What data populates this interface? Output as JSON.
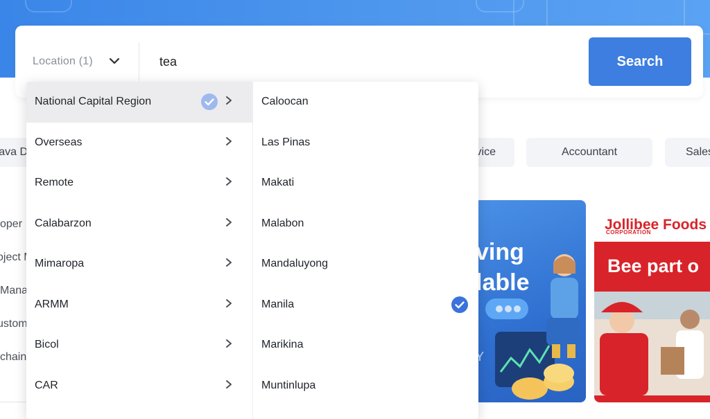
{
  "search": {
    "location_label": "Location (1)",
    "keyword_value": "tea",
    "button_label": "Search"
  },
  "chips": [
    "Java D",
    "vice",
    "Accountant",
    "Sales"
  ],
  "sidebar_items": [
    "oper",
    "oject M",
    "Manag",
    "ustom",
    "chain"
  ],
  "banners": {
    "banner1_line1": "ving",
    "banner1_line2": "lable",
    "banner1_letter": "Y",
    "jollibee_logo": "Jollibee Foods",
    "jollibee_corp": "CORPORATION",
    "jollibee_tagline": "Bee part o"
  },
  "dropdown": {
    "regions": [
      {
        "label": "National Capital Region",
        "selected": true
      },
      {
        "label": "Overseas",
        "selected": false
      },
      {
        "label": "Remote",
        "selected": false
      },
      {
        "label": "Calabarzon",
        "selected": false
      },
      {
        "label": "Mimaropa",
        "selected": false
      },
      {
        "label": "ARMM",
        "selected": false
      },
      {
        "label": "Bicol",
        "selected": false
      },
      {
        "label": "CAR",
        "selected": false
      }
    ],
    "cities": [
      {
        "label": "Caloocan",
        "checked": false
      },
      {
        "label": "Las Pinas",
        "checked": false
      },
      {
        "label": "Makati",
        "checked": false
      },
      {
        "label": "Malabon",
        "checked": false
      },
      {
        "label": "Mandaluyong",
        "checked": false
      },
      {
        "label": "Manila",
        "checked": true
      },
      {
        "label": "Marikina",
        "checked": false
      },
      {
        "label": "Muntinlupa",
        "checked": false
      }
    ]
  },
  "colors": {
    "accent": "#3d7ee0",
    "check_selected": "#3a73dc",
    "check_partial": "#9fb9ef",
    "hero": "#4a90e6",
    "jollibee_red": "#d8232a"
  },
  "icons": {
    "location_toggle": "chevron-down-icon",
    "row_arrow": "chevron-right-icon",
    "check": "check-circle-icon"
  }
}
